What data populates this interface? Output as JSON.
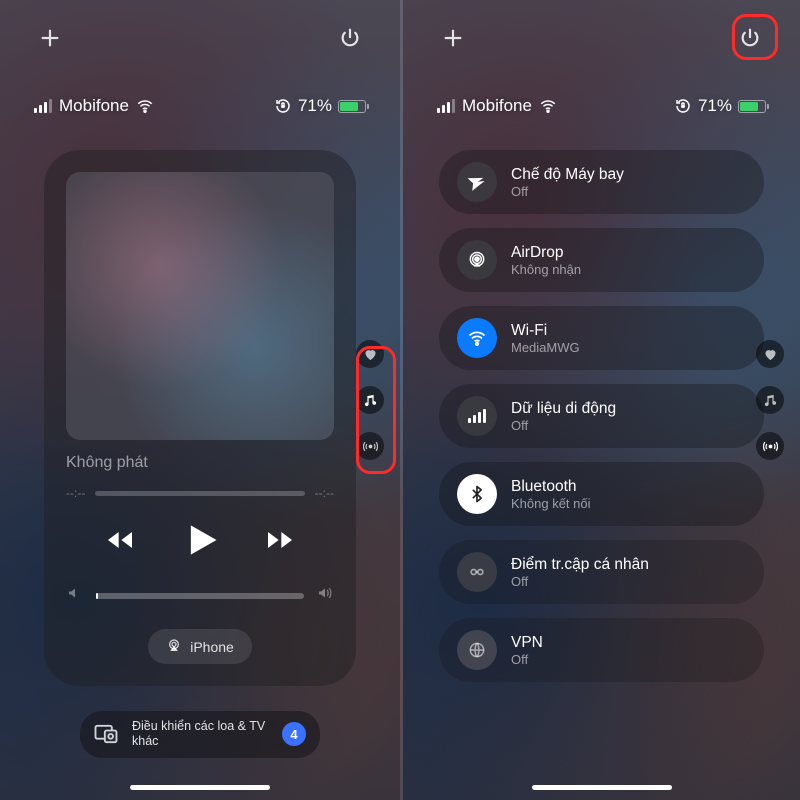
{
  "status": {
    "carrier": "Mobifone",
    "battery_pct": "71%"
  },
  "media": {
    "not_playing": "Không phát",
    "time_left": "--:--",
    "time_right": "--:--",
    "airplay_target": "iPhone"
  },
  "hint": {
    "text": "Điều khiển các loa & TV khác",
    "badge": "4"
  },
  "conn": {
    "airplane": {
      "title": "Chế độ Máy bay",
      "status": "Off"
    },
    "airdrop": {
      "title": "AirDrop",
      "status": "Không nhận"
    },
    "wifi": {
      "title": "Wi-Fi",
      "status": "MediaMWG"
    },
    "cellular": {
      "title": "Dữ liệu di động",
      "status": "Off"
    },
    "bluetooth": {
      "title": "Bluetooth",
      "status": "Không kết nối"
    },
    "hotspot": {
      "title": "Điểm tr.cập cá nhân",
      "status": "Off"
    },
    "vpn": {
      "title": "VPN",
      "status": "Off"
    }
  }
}
